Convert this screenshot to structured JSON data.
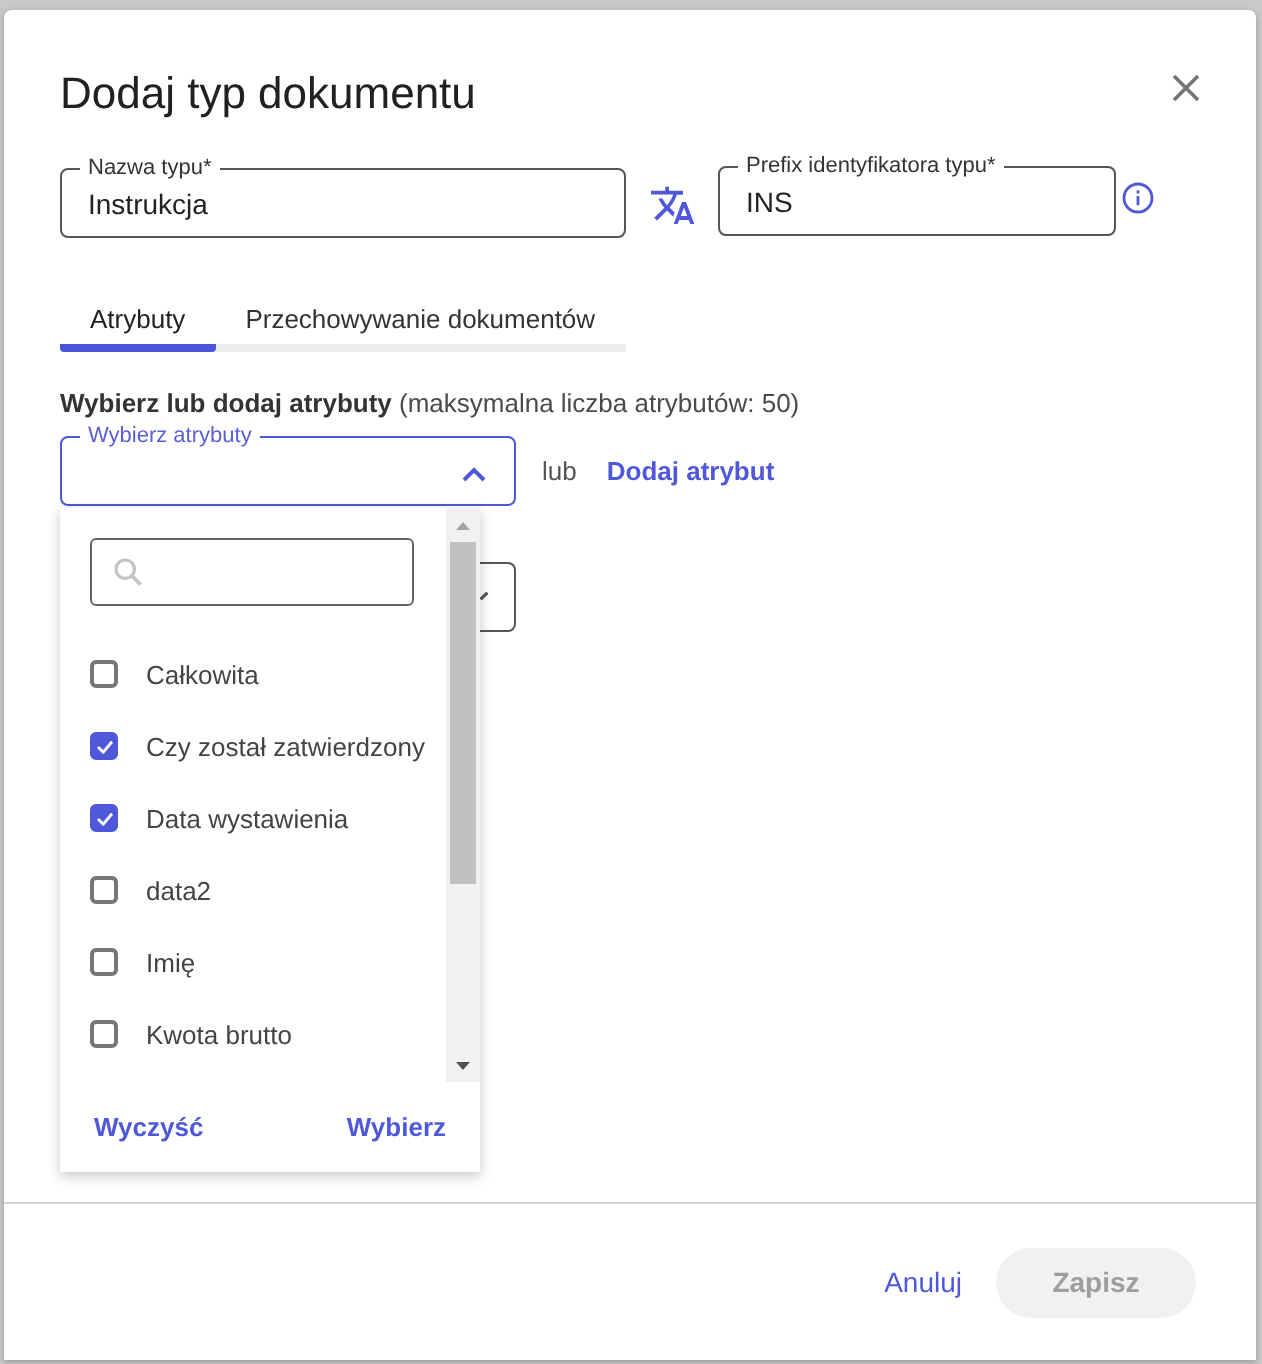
{
  "dialog": {
    "title": "Dodaj typ dokumentu"
  },
  "name_field": {
    "label": "Nazwa typu*",
    "value": "Instrukcja"
  },
  "prefix_field": {
    "label": "Prefix identyfikatora typu*",
    "value": "INS"
  },
  "tabs": [
    {
      "label": "Atrybuty",
      "selected": true
    },
    {
      "label": "Przechowywanie dokumentów",
      "selected": false
    }
  ],
  "attributes": {
    "heading": "**Wybierz lub dodaj atrybuty** (maksymalna liczba atrybutów: 50)",
    "select": {
      "label": "Wybierz atrybuty",
      "expanded": true
    },
    "or_text": "lub",
    "add_link": "Dodaj atrybut"
  },
  "dropdown": {
    "items": [
      {
        "label": "Całkowita",
        "checked": false
      },
      {
        "label": "Czy został zatwierdzony",
        "checked": true
      },
      {
        "label": "Data wystawienia",
        "checked": true
      },
      {
        "label": "data2",
        "checked": false
      },
      {
        "label": "Imię",
        "checked": false
      },
      {
        "label": "Kwota brutto",
        "checked": false
      }
    ],
    "clear_button": "Wyczyść",
    "apply_button": "Wybierz"
  },
  "footer": {
    "cancel_button": "Anuluj",
    "save_button": {
      "label": "Zapisz",
      "disabled": true
    }
  }
}
